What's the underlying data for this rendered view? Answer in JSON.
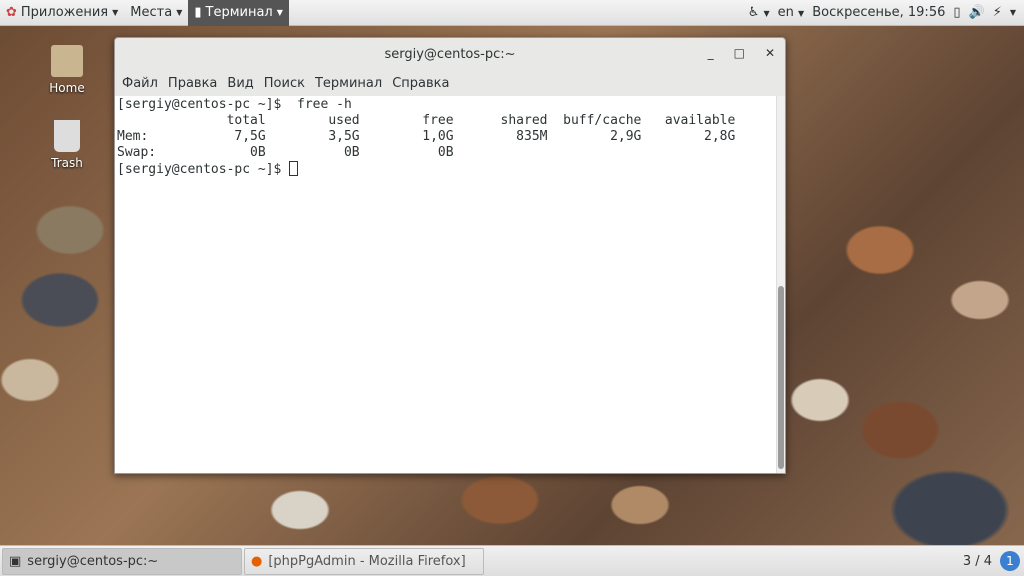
{
  "topbar": {
    "applications": "Приложения",
    "places": "Места",
    "terminal": "Терминал",
    "lang": "en",
    "datetime": "Воскресенье, 19:56"
  },
  "desktop": {
    "home": "Home",
    "trash": "Trash"
  },
  "window": {
    "title": "sergiy@centos-pc:~",
    "menu": [
      "Файл",
      "Правка",
      "Вид",
      "Поиск",
      "Терминал",
      "Справка"
    ],
    "lines": [
      "[sergiy@centos-pc ~]$  free -h",
      "              total        used        free      shared  buff/cache   available",
      "Mem:           7,5G        3,5G        1,0G        835M        2,9G        2,8G",
      "Swap:            0B          0B          0B"
    ],
    "prompt": "[sergiy@centos-pc ~]$ "
  },
  "taskbar": {
    "tasks": [
      "sergiy@centos-pc:~",
      "[phpPgAdmin - Mozilla Firefox]"
    ],
    "workspace": "3 / 4",
    "notifications": "1"
  }
}
